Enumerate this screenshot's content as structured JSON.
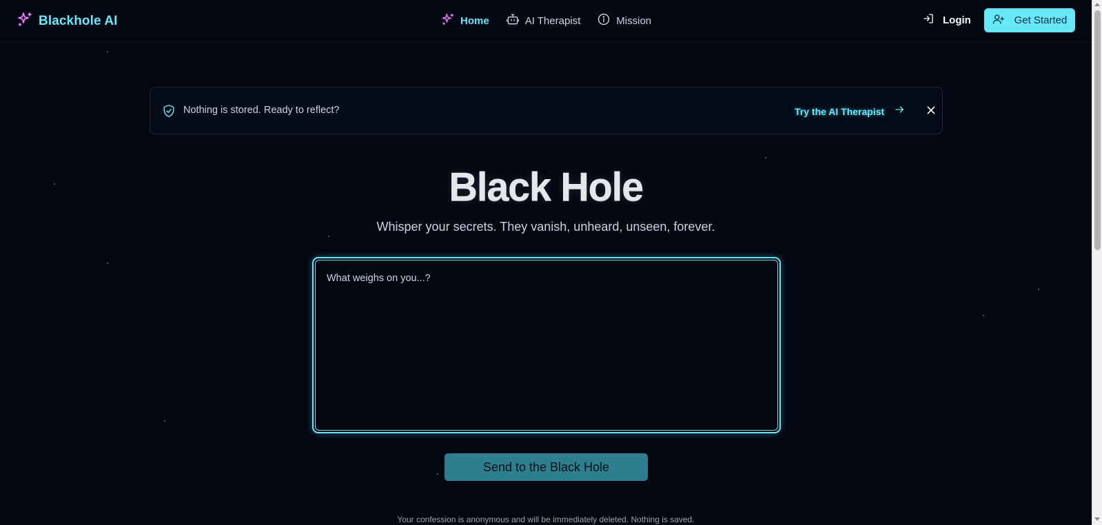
{
  "header": {
    "brand": "Blackhole AI",
    "nav": [
      {
        "label": "Home",
        "icon": "sparkle-icon",
        "active": true
      },
      {
        "label": "AI Therapist",
        "icon": "bot-icon",
        "active": false
      },
      {
        "label": "Mission",
        "icon": "info-icon",
        "active": false
      }
    ],
    "login_label": "Login",
    "get_started_label": "Get Started"
  },
  "banner": {
    "text": "Nothing is stored. Ready to reflect?",
    "cta_label": "Try the AI Therapist",
    "icon": "shield-check-icon"
  },
  "hero": {
    "title": "Black Hole",
    "subtitle": "Whisper your secrets. They vanish, unheard, unseen, forever."
  },
  "confession": {
    "placeholder": "What weighs on you...?",
    "value": ""
  },
  "send_label": "Send to the Black Hole",
  "footnote": "Your confession is anonymous and will be immediately deleted. Nothing is saved.",
  "colors": {
    "background": "#030712",
    "accent": "#67e8f9",
    "brand_icon": "#e879f9",
    "send_button": "#2f7e8e"
  }
}
